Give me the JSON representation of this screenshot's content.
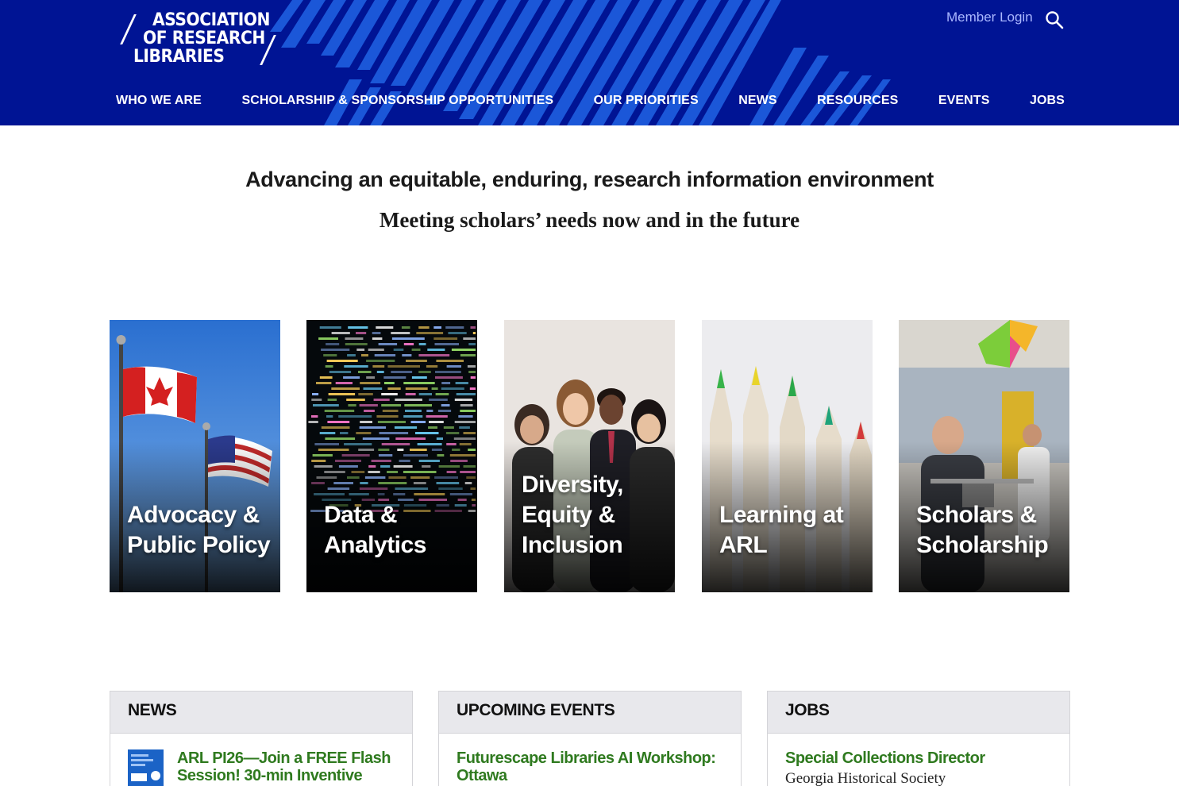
{
  "header": {
    "logo_lines": [
      "ASSOCIATION",
      "OF RESEARCH",
      "LIBRARIES"
    ],
    "member_login": "Member Login",
    "search_icon": "search-icon",
    "background_color": "#001494",
    "stripe_color": "#1f5fe0"
  },
  "nav": [
    {
      "label": "WHO WE ARE"
    },
    {
      "label": "SCHOLARSHIP & SPONSORSHIP OPPORTUNITIES"
    },
    {
      "label": "OUR PRIORITIES"
    },
    {
      "label": "NEWS"
    },
    {
      "label": "RESOURCES"
    },
    {
      "label": "EVENTS"
    },
    {
      "label": "JOBS"
    }
  ],
  "hero": {
    "headline": "Advancing an equitable, enduring, research information environment",
    "subline": "Meeting scholars’ needs now and in the future"
  },
  "tiles": [
    {
      "title": "Advocacy & Public Policy"
    },
    {
      "title": "Data & Analytics"
    },
    {
      "title": "Diversity, Equity & Inclusion"
    },
    {
      "title": "Learning at ARL"
    },
    {
      "title": "Scholars & Scholarship"
    }
  ],
  "panels": {
    "news": {
      "heading": "NEWS",
      "item_title": "ARL PI26—Join a FREE Flash Session! 30-min Inventive"
    },
    "events": {
      "heading": "UPCOMING EVENTS",
      "item_title": "Futurescape Libraries AI Workshop: Ottawa"
    },
    "jobs": {
      "heading": "JOBS",
      "item_title": "Special Collections Director",
      "item_org": "Georgia Historical Society"
    },
    "link_color": "#2f7a1f"
  }
}
